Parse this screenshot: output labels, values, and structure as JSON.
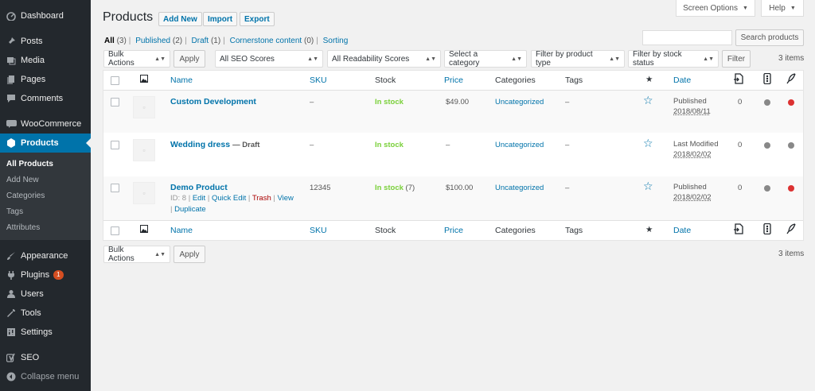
{
  "sidebar": {
    "items": [
      {
        "label": "Dashboard"
      },
      {
        "label": "Posts"
      },
      {
        "label": "Media"
      },
      {
        "label": "Pages"
      },
      {
        "label": "Comments"
      },
      {
        "label": "WooCommerce"
      },
      {
        "label": "Products"
      },
      {
        "label": "Appearance"
      },
      {
        "label": "Plugins",
        "badge": "1"
      },
      {
        "label": "Users"
      },
      {
        "label": "Tools"
      },
      {
        "label": "Settings"
      },
      {
        "label": "SEO"
      },
      {
        "label": "Collapse menu"
      }
    ],
    "submenu": [
      "All Products",
      "Add New",
      "Categories",
      "Tags",
      "Attributes"
    ]
  },
  "topbar": {
    "screen_options": "Screen Options",
    "help": "Help"
  },
  "header": {
    "title": "Products",
    "add_new": "Add New",
    "import": "Import",
    "export": "Export"
  },
  "filters": {
    "all": "All",
    "all_count": "(3)",
    "published": "Published",
    "published_count": "(2)",
    "draft": "Draft",
    "draft_count": "(1)",
    "cornerstone": "Cornerstone content",
    "cornerstone_count": "(0)",
    "sorting": "Sorting"
  },
  "search": {
    "placeholder": "",
    "button": "Search products"
  },
  "tablenav": {
    "bulk_actions": "Bulk Actions",
    "apply": "Apply",
    "seo_scores": "All SEO Scores",
    "readability": "All Readability Scores",
    "category": "Select a category",
    "product_type": "Filter by product type",
    "stock_status": "Filter by stock status",
    "filter": "Filter",
    "items": "3 items"
  },
  "columns": {
    "name": "Name",
    "sku": "SKU",
    "stock": "Stock",
    "price": "Price",
    "categories": "Categories",
    "tags": "Tags",
    "date": "Date"
  },
  "products": [
    {
      "name": "Custom Development",
      "draft": "",
      "sku": "–",
      "stock": "In stock",
      "stock_extra": "",
      "price": "$49.00",
      "category": "Uncategorized",
      "tags": "–",
      "date_status": "Published",
      "date_value": "2018/08/11",
      "links": "0",
      "readability": "gray",
      "seo": "red"
    },
    {
      "name": "Wedding dress",
      "draft": "— Draft",
      "sku": "–",
      "stock": "In stock",
      "stock_extra": "",
      "price": "–",
      "category": "Uncategorized",
      "tags": "–",
      "date_status": "Last Modified",
      "date_value": "2018/02/02",
      "links": "0",
      "readability": "gray",
      "seo": "gray"
    },
    {
      "name": "Demo Product",
      "draft": "",
      "sku": "12345",
      "stock": "In stock",
      "stock_extra": "(7)",
      "price": "$100.00",
      "category": "Uncategorized",
      "tags": "–",
      "date_status": "Published",
      "date_value": "2018/02/02",
      "links": "0",
      "readability": "gray",
      "seo": "red"
    }
  ],
  "row_actions": {
    "id": "ID: 8",
    "edit": "Edit",
    "quick_edit": "Quick Edit",
    "trash": "Trash",
    "view": "View",
    "duplicate": "Duplicate"
  },
  "colors": {
    "accent": "#0073aa",
    "sidebar": "#23282d",
    "in_stock": "#7ad03a",
    "seo_bad": "#dc3232",
    "neutral": "#888888"
  }
}
